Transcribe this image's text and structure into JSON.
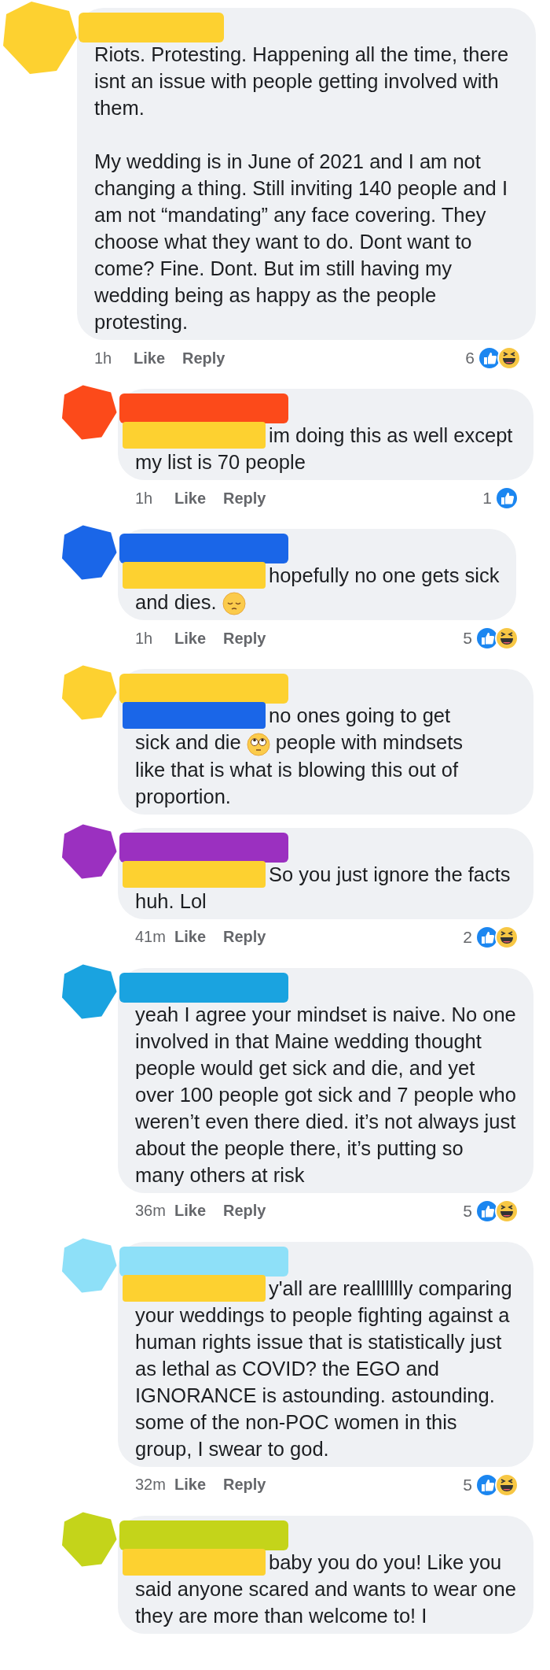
{
  "comments": [
    {
      "kind": "comment",
      "avatar": {
        "color": "#fdd130"
      },
      "name_marks": [
        {
          "color": "#fdd130"
        }
      ],
      "paragraphs": [
        [
          {
            "kind": "text",
            "text": "Riots. Protesting. Happening all the time, there isnt an issue with people getting involved with them."
          }
        ],
        [
          {
            "kind": "text",
            "text": "My wedding is in June of 2021 and I am not changing a thing. Still inviting 140 people and I am not “mandating” any face covering. They choose what they want to do. Dont want to come? Fine. Dont. But im still having my wedding being as happy as the people protesting."
          }
        ]
      ],
      "footer": {
        "time": "1h",
        "like": "Like",
        "reply": "Reply",
        "count": "6",
        "reactions": [
          {
            "kind": "like"
          },
          {
            "kind": "haha"
          }
        ]
      }
    },
    {
      "kind": "reply",
      "avatar": {
        "color": "#fc4a1a"
      },
      "name_marks": [
        {
          "color": "#fc4a1a"
        }
      ],
      "mention": {
        "color": "#fdd130"
      },
      "paragraphs": [
        [
          {
            "kind": "text",
            "text": "im doing this as well except my list is 70 people"
          }
        ]
      ],
      "footer": {
        "time": "1h",
        "like": "Like",
        "reply": "Reply",
        "count": "1",
        "reactions": [
          {
            "kind": "like"
          }
        ]
      }
    },
    {
      "kind": "reply",
      "avatar": {
        "color": "#1a66e8"
      },
      "name_marks": [
        {
          "color": "#1a66e8"
        }
      ],
      "mention": {
        "color": "#fdd130"
      },
      "paragraphs": [
        [
          {
            "kind": "text",
            "text": "hopefully no one gets sick"
          }
        ],
        [
          {
            "kind": "line"
          },
          {
            "kind": "text",
            "text": "and dies. "
          },
          {
            "kind": "pensive"
          }
        ]
      ],
      "footer": {
        "time": "1h",
        "like": "Like",
        "reply": "Reply",
        "count": "5",
        "reactions": [
          {
            "kind": "like"
          },
          {
            "kind": "haha"
          }
        ]
      }
    },
    {
      "kind": "reply",
      "avatar": {
        "color": "#fdd130"
      },
      "name_marks": [
        {
          "color": "#fdd130"
        }
      ],
      "mention": {
        "color": "#1a66e8"
      },
      "paragraphs": [
        [
          {
            "kind": "text",
            "text": "no ones going to get"
          }
        ],
        [
          {
            "kind": "line"
          },
          {
            "kind": "text",
            "text": "sick and die "
          },
          {
            "kind": "eyeroll"
          },
          {
            "kind": "text",
            "text": " people with mindsets"
          }
        ],
        [
          {
            "kind": "line"
          },
          {
            "kind": "text",
            "text": "like that is what is blowing this out of proportion."
          }
        ]
      ]
    },
    {
      "kind": "reply",
      "avatar": {
        "color": "#9b30c0"
      },
      "name_marks": [
        {
          "color": "#9b30c0"
        }
      ],
      "mention": {
        "color": "#fdd130"
      },
      "paragraphs": [
        [
          {
            "kind": "text",
            "text": "So you just ignore the facts huh. Lol"
          }
        ]
      ],
      "footer": {
        "time": "41m",
        "like": "Like",
        "reply": "Reply",
        "count": "2",
        "reactions": [
          {
            "kind": "like"
          },
          {
            "kind": "haha"
          }
        ]
      }
    },
    {
      "kind": "reply",
      "avatar": {
        "color": "#1aa3e0"
      },
      "name_marks": [
        {
          "color": "#1aa3e0"
        }
      ],
      "paragraphs": [
        [
          {
            "kind": "text",
            "text": "yeah I agree your mindset is naive. No one involved in that Maine wedding thought people would get sick and die, and yet over 100 people got sick and 7 people who weren’t even there died. it’s not always just about the people there, it’s putting so many others at risk"
          }
        ]
      ],
      "footer": {
        "time": "36m",
        "like": "Like",
        "reply": "Reply",
        "count": "5",
        "reactions": [
          {
            "kind": "like"
          },
          {
            "kind": "haha"
          }
        ]
      }
    },
    {
      "kind": "reply",
      "avatar": {
        "color": "#8ee0f8"
      },
      "name_marks": [
        {
          "color": "#8ee0f8"
        }
      ],
      "mention": {
        "color": "#fdd130"
      },
      "paragraphs": [
        [
          {
            "kind": "text",
            "text": "y'all are reallllllly comparing your weddings to people fighting against a human rights issue that is statistically just as lethal as COVID? the EGO and IGNORANCE is astounding. astounding. some of the non-POC women in this group, I swear to god."
          }
        ]
      ],
      "footer": {
        "time": "32m",
        "like": "Like",
        "reply": "Reply",
        "count": "5",
        "reactions": [
          {
            "kind": "like"
          },
          {
            "kind": "haha"
          }
        ]
      }
    },
    {
      "kind": "reply",
      "avatar": {
        "color": "#c4d41a"
      },
      "name_marks": [
        {
          "color": "#c4d41a"
        }
      ],
      "mention": {
        "color": "#fdd130"
      },
      "paragraphs": [
        [
          {
            "kind": "text",
            "text": "baby you do you! Like you said anyone scared and wants to wear one they are more than welcome to! I"
          }
        ]
      ]
    }
  ]
}
